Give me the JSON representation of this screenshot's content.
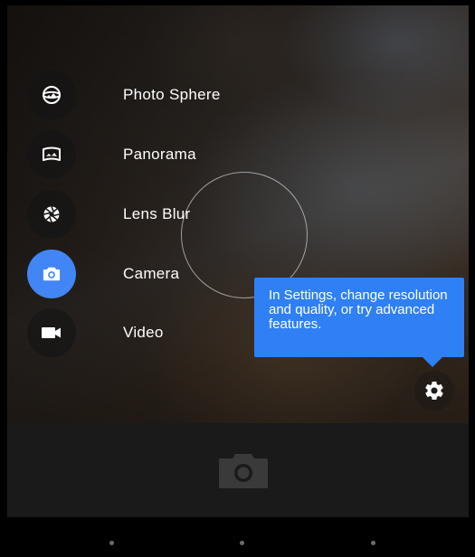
{
  "modes": [
    {
      "label": "Photo Sphere",
      "icon": "photo-sphere-icon",
      "active": false
    },
    {
      "label": "Panorama",
      "icon": "panorama-icon",
      "active": false
    },
    {
      "label": "Lens Blur",
      "icon": "lens-blur-icon",
      "active": false
    },
    {
      "label": "Camera",
      "icon": "camera-icon",
      "active": true
    },
    {
      "label": "Video",
      "icon": "video-icon",
      "active": false
    }
  ],
  "tooltip": {
    "text": "In Settings, change resolution and quality, or try advanced features."
  },
  "colors": {
    "accent": "#4285f4",
    "tooltip": "#2f80f5",
    "control_bar": "#1a1a1a"
  },
  "icons": {
    "settings": "gear-icon",
    "shutter": "camera-shutter-icon",
    "nav": [
      "nav-back-dot",
      "nav-home-dot",
      "nav-recents-dot"
    ]
  }
}
